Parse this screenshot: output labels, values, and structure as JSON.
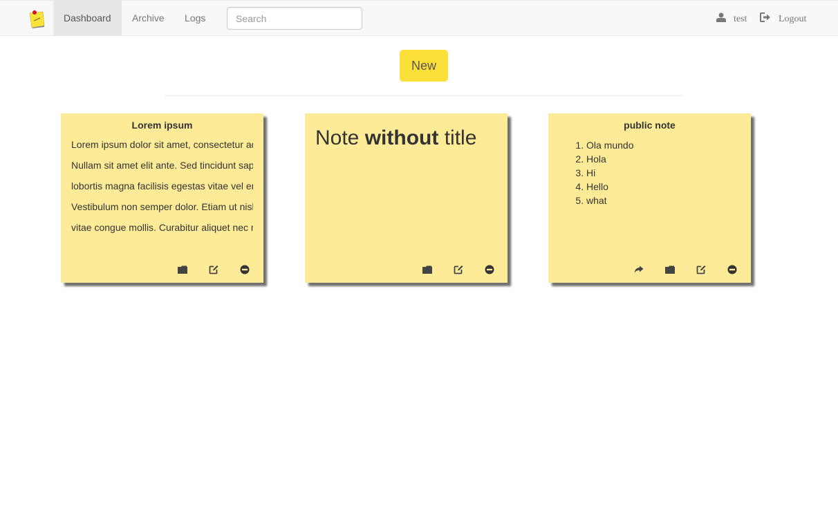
{
  "navbar": {
    "brand": "sticky-note-logo",
    "items": [
      {
        "label": "Dashboard",
        "active": true
      },
      {
        "label": "Archive",
        "active": false
      },
      {
        "label": "Logs",
        "active": false
      }
    ],
    "search": {
      "value": "",
      "placeholder": "Search"
    },
    "user": {
      "icon": "user-icon",
      "label": "test"
    },
    "logout": {
      "icon": "logout-icon",
      "label": "Logout"
    }
  },
  "main": {
    "new_button": "New"
  },
  "notes": [
    {
      "title": "Lorem ipsum",
      "lines": [
        "Lorem ipsum dolor sit amet, consectetur adipiscing elit.",
        "Nullam sit amet elit ante. Sed tincidunt sapien",
        "lobortis magna facilisis egestas vitae vel erat.",
        "Vestibulum non semper dolor. Etiam ut nisl",
        "vitae congue mollis. Curabitur aliquet nec nisi"
      ],
      "actions": [
        "archive-icon",
        "edit-icon",
        "delete-icon"
      ]
    },
    {
      "heading_normal_1": "Note ",
      "heading_bold": "without",
      "heading_normal_2": " title",
      "actions": [
        "archive-icon",
        "edit-icon",
        "delete-icon"
      ]
    },
    {
      "title": "public note",
      "list": [
        "Ola mundo",
        "Hola",
        "Hi",
        "Hello",
        "what"
      ],
      "actions": [
        "share-icon",
        "archive-icon",
        "edit-icon",
        "delete-icon"
      ]
    }
  ],
  "colors": {
    "note_bg": "#fdeb97",
    "new_button_bg": "#fddf3a",
    "navbar_bg": "#f8f8f8"
  }
}
